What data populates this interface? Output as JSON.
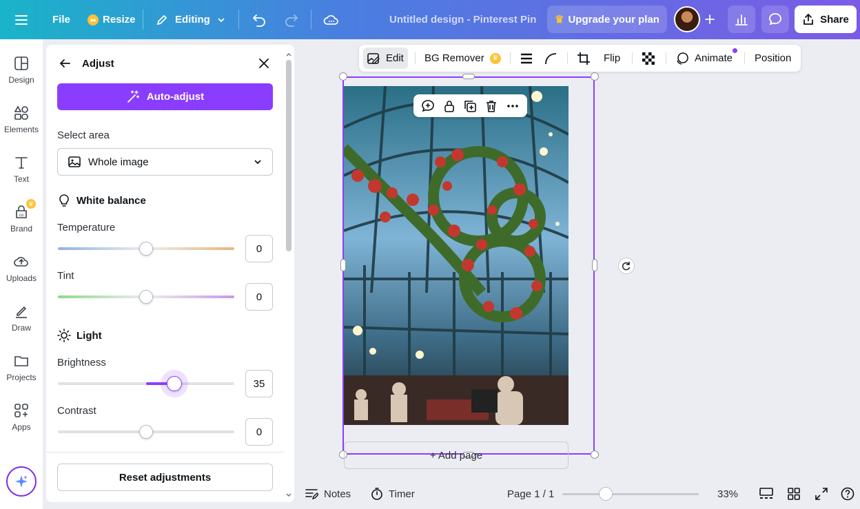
{
  "topbar": {
    "file": "File",
    "resize": "Resize",
    "editing": "Editing",
    "title": "Untitled design - Pinterest Pin",
    "upgrade": "Upgrade your plan",
    "share": "Share"
  },
  "rail": {
    "items": [
      {
        "label": "Design",
        "icon": "design-icon"
      },
      {
        "label": "Elements",
        "icon": "elements-icon"
      },
      {
        "label": "Text",
        "icon": "text-icon"
      },
      {
        "label": "Brand",
        "icon": "brand-icon"
      },
      {
        "label": "Uploads",
        "icon": "uploads-icon"
      },
      {
        "label": "Draw",
        "icon": "draw-icon"
      },
      {
        "label": "Projects",
        "icon": "projects-icon"
      },
      {
        "label": "Apps",
        "icon": "apps-icon"
      }
    ]
  },
  "panel": {
    "title": "Adjust",
    "auto_adjust": "Auto-adjust",
    "select_area_label": "Select area",
    "select_area_value": "Whole image",
    "white_balance": "White balance",
    "temperature_label": "Temperature",
    "temperature_value": "0",
    "tint_label": "Tint",
    "tint_value": "0",
    "light": "Light",
    "brightness_label": "Brightness",
    "brightness_value": "35",
    "contrast_label": "Contrast",
    "contrast_value": "0",
    "reset": "Reset adjustments"
  },
  "toolbar": {
    "edit": "Edit",
    "bg_remover": "BG Remover",
    "flip": "Flip",
    "animate": "Animate",
    "position": "Position"
  },
  "canvas": {
    "add_page": "+ Add page"
  },
  "bottom": {
    "notes": "Notes",
    "timer": "Timer",
    "page": "Page 1 / 1",
    "zoom": "33%"
  },
  "colors": {
    "accent": "#8b3dff",
    "gradient_start": "#19b4c9",
    "gradient_end": "#7b5be6"
  }
}
